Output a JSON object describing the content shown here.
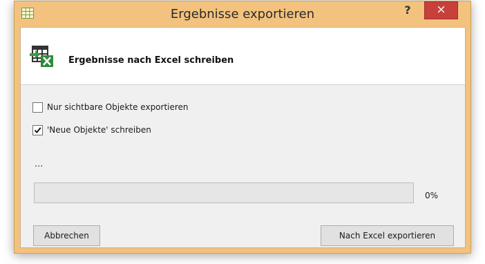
{
  "window": {
    "title": "Ergebnisse exportieren",
    "help_label": "?",
    "close_label": "×",
    "accent_color": "#f2c27e",
    "close_color": "#c7403a"
  },
  "header": {
    "title": "Ergebnisse nach Excel schreiben"
  },
  "options": [
    {
      "label": "Nur sichtbare Objekte exportieren",
      "checked": false
    },
    {
      "label": "'Neue Objekte' schreiben",
      "checked": true
    }
  ],
  "status": {
    "text": "...",
    "progress_fraction": 0,
    "progress_label": "0%"
  },
  "buttons": {
    "cancel_label": "Abbrechen",
    "export_label": "Nach Excel exportieren"
  },
  "icons": {
    "app": "grid-icon",
    "header": "excel-export-icon",
    "close": "close-icon",
    "help": "help-icon"
  }
}
